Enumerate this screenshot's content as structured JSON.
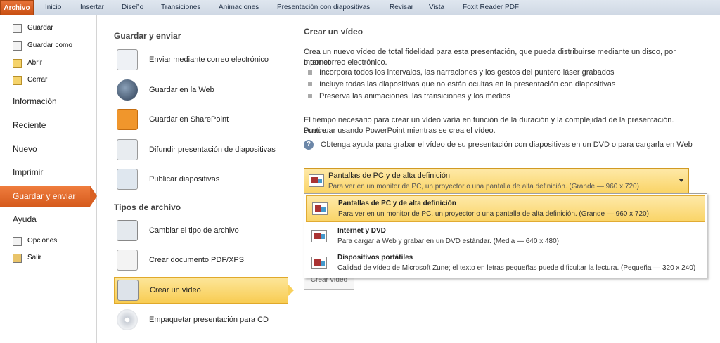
{
  "ribbon": {
    "tabs": [
      "Archivo",
      "Inicio",
      "Insertar",
      "Diseño",
      "Transiciones",
      "Animaciones",
      "Presentación con diapositivas",
      "Revisar",
      "Vista",
      "Foxit Reader PDF"
    ]
  },
  "nav": {
    "small_top": [
      "Guardar",
      "Guardar como",
      "Abrir",
      "Cerrar"
    ],
    "big": [
      "Información",
      "Reciente",
      "Nuevo",
      "Imprimir"
    ],
    "active": "Guardar y enviar",
    "ayuda": "Ayuda",
    "small_bottom": [
      "Opciones",
      "Salir"
    ]
  },
  "middle": {
    "section1": "Guardar y enviar",
    "items1": [
      "Enviar mediante correo electrónico",
      "Guardar en la Web",
      "Guardar en SharePoint",
      "Difundir presentación de diapositivas",
      "Publicar diapositivas"
    ],
    "section2": "Tipos de archivo",
    "items2": [
      "Cambiar el tipo de archivo",
      "Crear documento PDF/XPS",
      "Crear un vídeo",
      "Empaquetar presentación para CD"
    ]
  },
  "content": {
    "title": "Crear un vídeo",
    "intro_line1": "Crea un nuevo vídeo de total fidelidad para esta presentación, que pueda distribuirse mediante un disco, por Internet",
    "intro_line2": "o por correo electrónico.",
    "bullets": [
      "Incorpora todos los intervalos, las narraciones y los gestos del puntero láser grabados",
      "Incluye todas las diapositivas que no están ocultas en la presentación con diapositivas",
      "Preserva las animaciones, las transiciones y los medios"
    ],
    "time_line1": "El tiempo necesario para crear un vídeo varía en función de la duración y la complejidad de la presentación. Puede",
    "time_line2": "continuar usando PowerPoint mientras se crea el vídeo.",
    "help_link": "Obtenga ayuda para grabar el vídeo de su presentación con diapositivas en un DVD o para cargarla en Web",
    "dropdown": {
      "title": "Pantallas de PC y de alta definición",
      "desc": "Para ver en un monitor de PC, un proyector o una pantalla de alta definición. (Grande — 960 x 720)"
    },
    "options": [
      {
        "title": "Pantallas de PC y de alta definición",
        "desc": "Para ver en un monitor de PC, un proyector o una pantalla de alta definición. (Grande — 960 x 720)"
      },
      {
        "title": "Internet y DVD",
        "desc": "Para cargar a Web y grabar en un DVD estándar. (Media — 640 x 480)"
      },
      {
        "title": "Dispositivos portátiles",
        "desc": "Calidad de vídeo de Microsoft Zune; el texto en letras pequeñas puede dificultar la lectura. (Pequeña — 320 x 240)"
      }
    ],
    "create_button": "Crear vídeo"
  }
}
